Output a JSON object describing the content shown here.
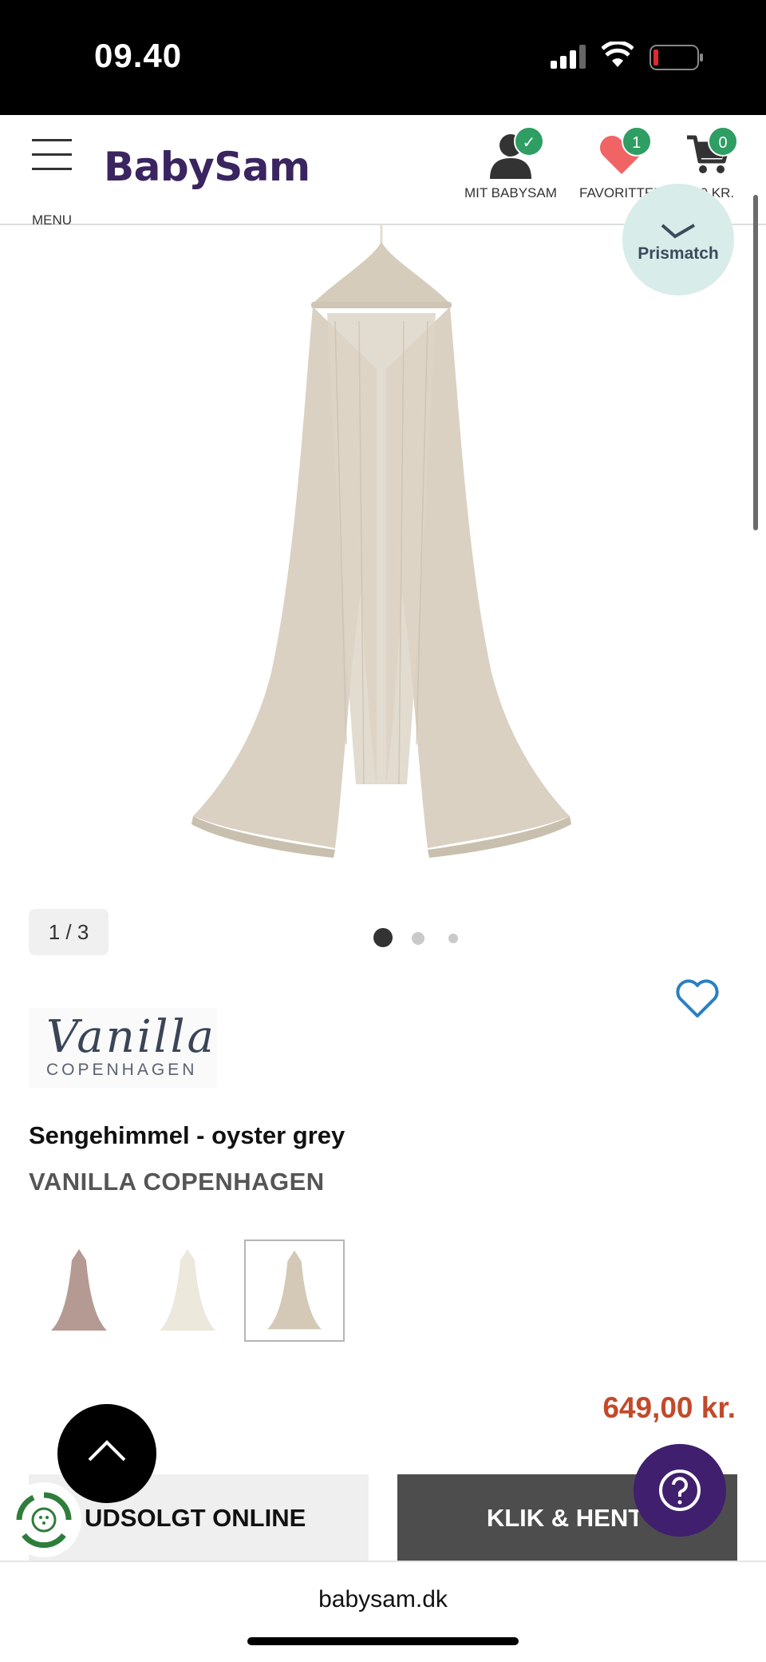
{
  "status": {
    "time": "09.40"
  },
  "header": {
    "menu_label": "MENU",
    "logo": "BabySam",
    "account_label": "MIT BABYSAM",
    "favorites_label": "FAVORITTER",
    "favorites_count": "1",
    "cart_label": "0,00 KR.",
    "cart_count": "0"
  },
  "badges": {
    "prismatch": "Prismatch"
  },
  "gallery": {
    "counter": "1 / 3",
    "active_index": 1,
    "total": 3
  },
  "brand_logo": {
    "name": "Vanilla",
    "sub": "COPENHAGEN"
  },
  "product": {
    "title": "Sengehimmel - oyster grey",
    "brand": "VANILLA COPENHAGEN",
    "price": "649,00 kr.",
    "variants": [
      {
        "color": "#b59a93"
      },
      {
        "color": "#ede8dc"
      },
      {
        "color": "#d4c8b6",
        "selected": true
      }
    ]
  },
  "actions": {
    "soldout_label": "UDSOLGT ONLINE",
    "click_collect_label": "KLIK & HENT"
  },
  "browser": {
    "url": "babysam.dk"
  },
  "colors": {
    "brand_purple": "#3a2560",
    "price_red": "#c24a2a",
    "badge_green": "#2e9e63",
    "canopy": "#d8cfc0"
  }
}
